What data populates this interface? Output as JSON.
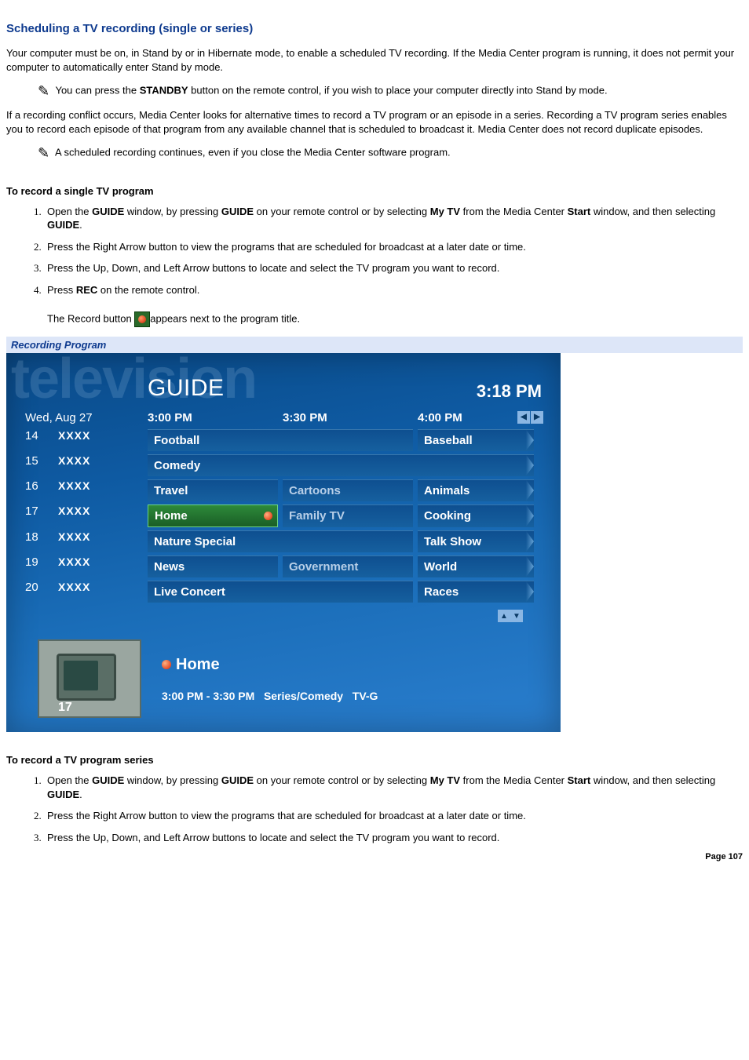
{
  "title": "Scheduling a TV recording (single or series)",
  "intro": "Your computer must be on, in Stand by or in Hibernate mode, to enable a scheduled TV recording. If the Media Center program is running, it does not permit your computer to automatically enter Stand by mode.",
  "note1_pre": " You can press the ",
  "note1_bold": "STANDBY",
  "note1_post": " button on the remote control, if you wish to place your computer directly into Stand by mode.",
  "para2": "If a recording conflict occurs, Media Center looks for alternative times to record a TV program or an episode in a series. Recording a TV program series enables you to record each episode of that program from any available channel that is scheduled to broadcast it. Media Center does not record duplicate episodes.",
  "note2": " A scheduled recording continues, even if you close the Media Center software program.",
  "sub1": "To record a single TV program",
  "steps1": {
    "s1a": "Open the ",
    "s1b": "GUIDE",
    "s1c": " window, by pressing ",
    "s1d": "GUIDE",
    "s1e": " on your remote control or by selecting ",
    "s1f": "My TV",
    "s1g": " from the Media Center ",
    "s1h": "Start",
    "s1i": " window, and then selecting ",
    "s1j": "GUIDE",
    "s1k": ".",
    "s2": "Press the Right Arrow button to view the programs that are scheduled for broadcast at a later date or time.",
    "s3": "Press the Up, Down, and Left Arrow buttons to locate and select the TV program you want to record.",
    "s4a": "Press ",
    "s4b": "REC",
    "s4c": " on the remote control.",
    "s5a": "The Record button ",
    "s5b": "appears next to the program title."
  },
  "caption": "Recording Program",
  "guide": {
    "brand": "television",
    "title": "GUIDE",
    "clock": "3:18 PM",
    "date": "Wed, Aug 27",
    "cols": [
      "3:00 PM",
      "3:30 PM",
      "4:00 PM"
    ],
    "rows": [
      {
        "num": "14",
        "name": "XXXX",
        "cells": [
          {
            "t": "Football",
            "span": 2
          },
          {
            "t": "Baseball",
            "last": true
          }
        ]
      },
      {
        "num": "15",
        "name": "XXXX",
        "cells": [
          {
            "t": "Comedy",
            "span": 3,
            "last": true
          }
        ]
      },
      {
        "num": "16",
        "name": "XXXX",
        "cells": [
          {
            "t": "Travel"
          },
          {
            "t": "Cartoons",
            "dim": true
          },
          {
            "t": "Animals",
            "last": true
          }
        ]
      },
      {
        "num": "17",
        "name": "XXXX",
        "cells": [
          {
            "t": "Home",
            "selected": true,
            "rec": true
          },
          {
            "t": "Family TV",
            "dim": true
          },
          {
            "t": "Cooking",
            "last": true
          }
        ]
      },
      {
        "num": "18",
        "name": "XXXX",
        "cells": [
          {
            "t": "Nature Special",
            "span": 2
          },
          {
            "t": "Talk Show",
            "last": true
          }
        ]
      },
      {
        "num": "19",
        "name": "XXXX",
        "cells": [
          {
            "t": "News"
          },
          {
            "t": "Government",
            "dim": true
          },
          {
            "t": "World",
            "last": true
          }
        ]
      },
      {
        "num": "20",
        "name": "XXXX",
        "cells": [
          {
            "t": "Live Concert",
            "span": 2
          },
          {
            "t": "Races",
            "last": true
          }
        ]
      }
    ],
    "detail": {
      "channel": "17",
      "title": "Home",
      "time": "3:00 PM - 3:30 PM",
      "genre": "Series/Comedy",
      "rating": "TV-G"
    }
  },
  "sub2": "To record a TV program series",
  "steps2": {
    "s2": "Press the Right Arrow button to view the programs that are scheduled for broadcast at a later date or time.",
    "s3": "Press the Up, Down, and Left Arrow buttons to locate and select the TV program you want to record."
  },
  "page_label": "Page 107"
}
